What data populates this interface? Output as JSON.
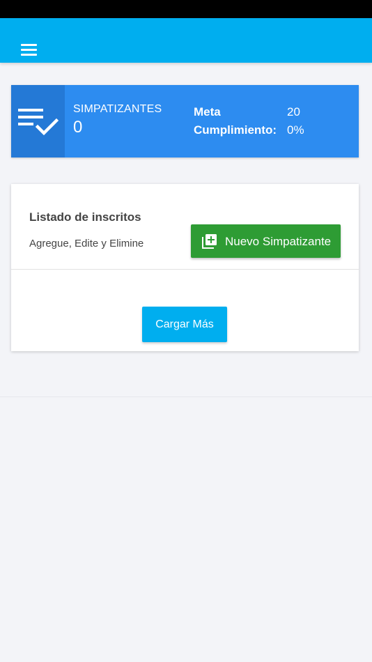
{
  "app_bar": {
    "color": "#00aeef",
    "menu_icon": "hamburger-menu-icon"
  },
  "stats": {
    "icon": "checklist-icon",
    "label": "SIMPATIZANTES",
    "value": "0",
    "meta_label": "Meta",
    "meta_value": "20",
    "cumplimiento_label": "Cumplimiento:",
    "cumplimiento_value": "0%",
    "background": "#2d8cf0"
  },
  "list": {
    "title": "Listado de inscritos",
    "subtitle": "Agregue, Edite y Elimine",
    "new_button": {
      "icon": "add-to-library-icon",
      "label": "Nuevo Simpatizante",
      "color": "#2e9c34"
    },
    "load_more_label": "Cargar Más"
  }
}
